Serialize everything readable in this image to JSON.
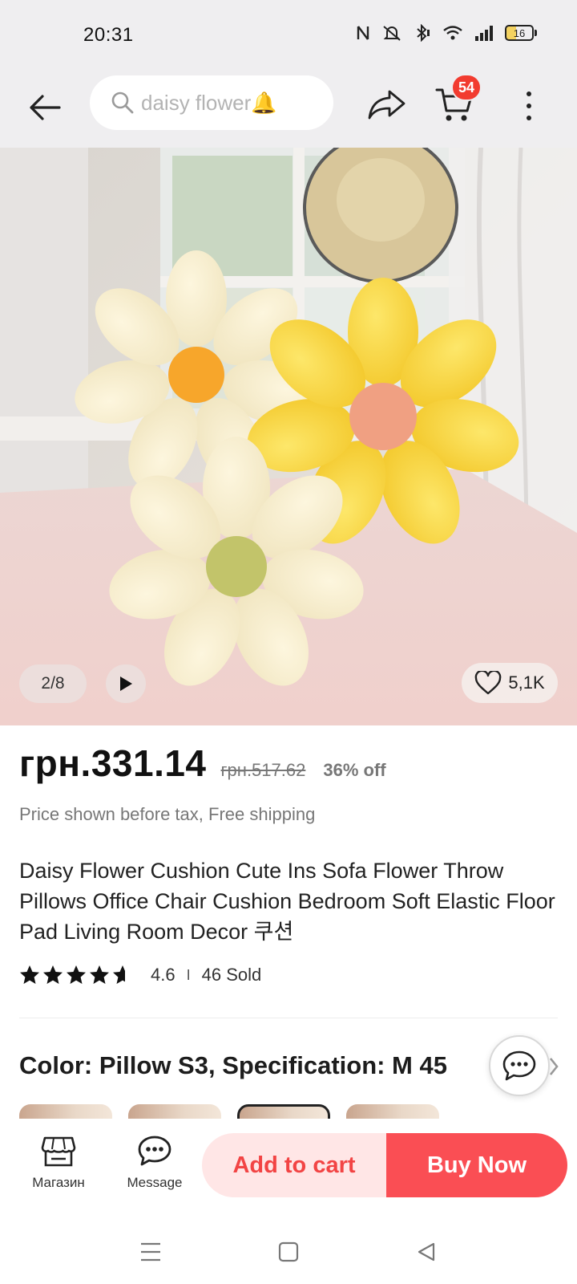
{
  "status_bar": {
    "time": "20:31",
    "battery": "16",
    "icons": [
      "nfc-icon",
      "mute-icon",
      "bluetooth-icon",
      "wifi-icon",
      "signal-icon",
      "battery-icon"
    ]
  },
  "header": {
    "search_text": "daisy flower🔔",
    "cart_count": "54",
    "icons": [
      "back-arrow-icon",
      "search-icon",
      "share-icon",
      "cart-icon",
      "more-vertical-icon"
    ]
  },
  "gallery": {
    "counter": "2/8",
    "favorites_count": "5,1K"
  },
  "price": {
    "current": "грн.331.14",
    "original": "грн.517.62",
    "discount": "36% off",
    "note": "Price shown before tax, Free shipping"
  },
  "product": {
    "title": "Daisy Flower Cushion Cute Ins Sofa Flower Throw Pillows Office Chair Cushion Bedroom Soft Elastic Floor Pad Living Room Decor 쿠션",
    "rating": "4.6",
    "rating_stars": 4.6,
    "sold": "46 Sold"
  },
  "variant": {
    "title": "Color: Pillow S3, Specification: M 45"
  },
  "action_bar": {
    "store_label": "Магазин",
    "message_label": "Message",
    "add_to_cart": "Add to cart",
    "buy_now": "Buy Now"
  },
  "colors": {
    "accent": "#fa4e54",
    "accent_light": "#ffe6e6",
    "badge": "#f23b2f"
  }
}
